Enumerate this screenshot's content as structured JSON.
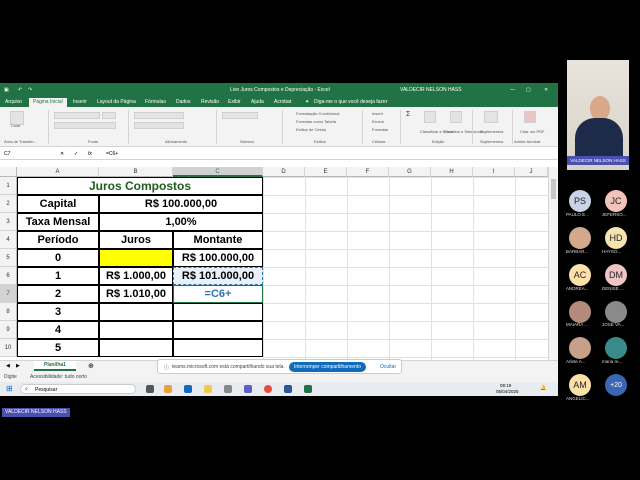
{
  "excel": {
    "title": "Live Juros Compostos e Depreciação  -  Excel",
    "user": "VALDECIR NELSON HASS",
    "tabs": [
      "Arquivo",
      "Página Inicial",
      "Inserir",
      "Layout da Página",
      "Fórmulas",
      "Dados",
      "Revisão",
      "Exibir",
      "Ajuda",
      "Acrobat"
    ],
    "search_placeholder": "Diga-me o que você deseja fazer",
    "ribbon_groups": [
      "Área de Transfer...",
      "Fonte",
      "Alinhamento",
      "Número",
      "Estilos",
      "Células",
      "Edição",
      "Suplementos",
      "Adobe Acrobat"
    ],
    "ribbon_labels": {
      "paste": "Colar",
      "cond_format": "Formatação Condicional",
      "format_table": "Formatar como Tabela",
      "cell_styles": "Estilos de Célula",
      "insert": "Inserir",
      "delete": "Excluir",
      "format": "Formatar",
      "sort": "Classificar e Filtrar",
      "find": "Localizar e Selecionar",
      "addins": "Suplementos",
      "pdf": "Criar um PDF"
    },
    "name_box": "C7",
    "formula": "=C6+",
    "columns": [
      "A",
      "B",
      "C",
      "D",
      "E",
      "F",
      "G",
      "H",
      "I",
      "J"
    ],
    "rows": [
      "1",
      "2",
      "3",
      "4",
      "5",
      "6",
      "7",
      "8",
      "9",
      "10"
    ],
    "cells": {
      "a1": "Juros Compostos",
      "a2": "Capital",
      "b2": "R$ 100.000,00",
      "a3": "Taxa Mensal",
      "b3": "1,00%",
      "a4": "Período",
      "b4": "Juros",
      "c4": "Montante",
      "a5": "0",
      "c5": "R$ 100.000,00",
      "a6": "1",
      "b6": "R$ 1.000,00",
      "c6": "R$ 101.000,00",
      "a7": "2",
      "b7": "R$ 1.010,00",
      "c7": "=C6+",
      "a8": "3",
      "a9": "4",
      "a10": "5"
    },
    "sheet_tab": "Planilha1",
    "status_left": "Digite",
    "status_accessibility": "Acessibilidade: tudo certo"
  },
  "banner": {
    "text": "teams.microsoft.com está compartilhando sua tela.",
    "stop_button": "Interromper compartilhamento",
    "hide_button": "Ocultar"
  },
  "taskbar": {
    "search": "Pesquisar",
    "time": "09:19",
    "date": "05/04/2025"
  },
  "presenter": {
    "name": "VALDECIR NELSON HASS"
  },
  "self_label": "VALDECIR NELSON HASS",
  "participants": [
    {
      "initials": "PS",
      "name": "PAULO E...",
      "color": "#c9d3e6"
    },
    {
      "initials": "JC",
      "name": "JEFERSO...",
      "color": "#f0c4b8"
    },
    {
      "initials": "",
      "name": "BARBAR...",
      "color": "#d2a98c"
    },
    {
      "initials": "HD",
      "name": "HAYSO...",
      "color": "#f7e3b0"
    },
    {
      "initials": "AC",
      "name": "ANDREA...",
      "color": "#fbe0a8"
    },
    {
      "initials": "DM",
      "name": "DENISE ...",
      "color": "#f0c4c4"
    },
    {
      "initials": "",
      "name": "MAIARA ...",
      "color": "#b48a7a"
    },
    {
      "initials": "",
      "name": "JOSÉ VA...",
      "color": "#8a8a8a"
    },
    {
      "initials": "",
      "name": "Arlete A...",
      "color": "#c7a08a"
    },
    {
      "initials": "",
      "name": "maria re...",
      "color": "#3a8a8a"
    },
    {
      "initials": "AM",
      "name": "ANGELIC...",
      "color": "#fbe0a8"
    }
  ],
  "more_count": "+20"
}
